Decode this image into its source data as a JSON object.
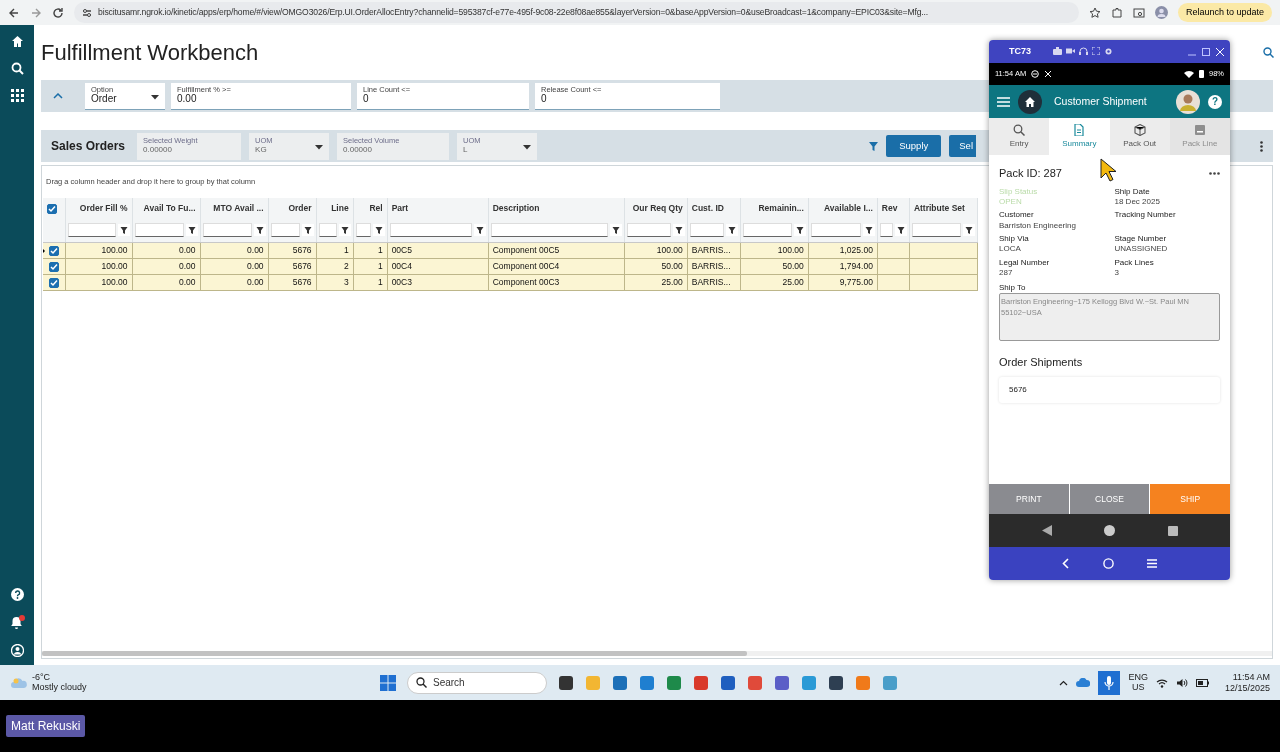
{
  "browser": {
    "url": "biscitusamr.ngrok.io/kinetic/apps/erp/home/#/view/OMGO3026/Erp.UI.OrderAllocEntry?channelid=595387cf-e77e-495f-9c08-22e8f08ae855&layerVersion=0&baseAppVersion=0&useBroadcast=1&company=EPIC03&site=Mfg...",
    "relaunch": "Relaunch to update"
  },
  "page_title": "Fulfillment Workbench",
  "filters": [
    {
      "kind": "select",
      "label": "Option",
      "value": "Order"
    },
    {
      "kind": "text",
      "label": "Fulfillment % >=",
      "value": "0.00"
    },
    {
      "kind": "text",
      "label": "Line Count <=",
      "value": "0"
    },
    {
      "kind": "text",
      "label": "Release Count <=",
      "value": "0"
    }
  ],
  "sales_orders": {
    "title": "Sales Orders",
    "fields": [
      {
        "kind": "text",
        "label": "Selected Weight",
        "value": "0.00000"
      },
      {
        "kind": "select",
        "label": "UOM",
        "value": "KG"
      },
      {
        "kind": "text",
        "label": "Selected Volume",
        "value": "0.00000"
      },
      {
        "kind": "select",
        "label": "UOM",
        "value": "L"
      }
    ],
    "buttons": [
      "Supply",
      "Sel"
    ]
  },
  "grid": {
    "hint": "Drag a column header and drop it here to group by that column",
    "all_checked": true,
    "columns": [
      {
        "label": "Order Fill %",
        "kind": "number"
      },
      {
        "label": "Avail To Fu...",
        "kind": "number"
      },
      {
        "label": "MTO Avail ...",
        "kind": "number"
      },
      {
        "label": "Order",
        "kind": "number"
      },
      {
        "label": "Line",
        "kind": "number"
      },
      {
        "label": "Rel",
        "kind": "number"
      },
      {
        "label": "Part",
        "kind": "text"
      },
      {
        "label": "Description",
        "kind": "text"
      },
      {
        "label": "Our Req Qty",
        "kind": "number"
      },
      {
        "label": "Cust. ID",
        "kind": "text"
      },
      {
        "label": "Remainin...",
        "kind": "number"
      },
      {
        "label": "Available I...",
        "kind": "number"
      },
      {
        "label": "Rev",
        "kind": "text"
      },
      {
        "label": "Attribute Set",
        "kind": "text"
      }
    ],
    "rows": [
      {
        "checked": true,
        "current": true,
        "cells": [
          "100.00",
          "0.00",
          "0.00",
          "5676",
          "1",
          "1",
          "00C5",
          "Component 00C5",
          "100.00",
          "BARRIS...",
          "100.00",
          "1,025.00"
        ]
      },
      {
        "checked": true,
        "current": false,
        "cells": [
          "100.00",
          "0.00",
          "0.00",
          "5676",
          "2",
          "1",
          "00C4",
          "Component 00C4",
          "50.00",
          "BARRIS...",
          "50.00",
          "1,794.00"
        ]
      },
      {
        "checked": true,
        "current": false,
        "cells": [
          "100.00",
          "0.00",
          "0.00",
          "5676",
          "3",
          "1",
          "00C3",
          "Component 00C3",
          "25.00",
          "BARRIS...",
          "25.00",
          "9,775.00"
        ]
      }
    ]
  },
  "device": {
    "window_title": "TC73",
    "time": "11:54 AM",
    "battery": "98%",
    "app_title": "Customer Shipment",
    "help": "?",
    "tabs": [
      {
        "label": "Entry",
        "selected": false,
        "disabled": false
      },
      {
        "label": "Summary",
        "selected": true,
        "disabled": false
      },
      {
        "label": "Pack Out",
        "selected": false,
        "disabled": false
      },
      {
        "label": "Pack Line",
        "selected": false,
        "disabled": true
      }
    ],
    "pack_id": "Pack ID: 287",
    "fields": [
      {
        "label": "Slip Status",
        "value": "OPEN",
        "muted": true
      },
      {
        "label": "Ship Date",
        "value": "18 Dec 2025",
        "muted": false
      },
      {
        "label": "Customer",
        "value": "Barriston Engineering",
        "muted": false
      },
      {
        "label": "Tracking Number",
        "muted": false
      },
      {
        "label": "Ship Via",
        "value": "LOCA",
        "muted": false
      },
      {
        "label": "Stage Number",
        "value": "UNASSIGNED",
        "muted": false
      },
      {
        "label": "Legal Number",
        "value": "287",
        "muted": false
      },
      {
        "label": "Pack Lines",
        "value": "3",
        "muted": false
      }
    ],
    "ship_to": {
      "label": "Ship To",
      "value": "Barriston Engineering~175 Kellogg Blvd W.~St. Paul MN 55102~USA"
    },
    "order_shipments": {
      "title": "Order Shipments",
      "items": [
        "5676"
      ]
    },
    "actions": [
      {
        "label": "PRINT",
        "kind": "plain"
      },
      {
        "label": "CLOSE",
        "kind": "plain"
      },
      {
        "label": "SHIP",
        "kind": "primary"
      }
    ]
  },
  "taskbar": {
    "temperature": "-6°C",
    "weather": "Mostly cloudy",
    "search": "Search",
    "lang": "ENG",
    "region": "US",
    "time": "11:54 AM",
    "date": "12/15/2025"
  },
  "presenter": "Matt Rekuski"
}
